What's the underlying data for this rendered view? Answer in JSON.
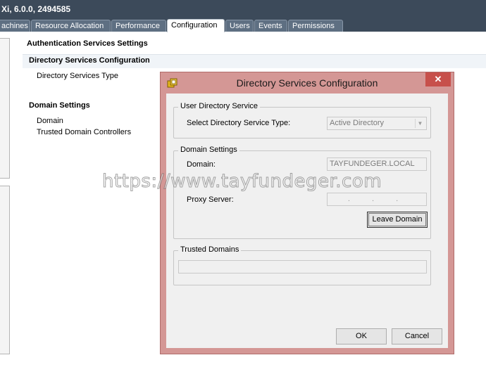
{
  "window": {
    "title": "Xi, 6.0.0, 2494585"
  },
  "tabs": [
    {
      "label": "achines"
    },
    {
      "label": "Resource Allocation"
    },
    {
      "label": "Performance"
    },
    {
      "label": "Configuration",
      "active": true
    },
    {
      "label": "Users"
    },
    {
      "label": "Events"
    },
    {
      "label": "Permissions"
    }
  ],
  "page": {
    "heading": "Authentication Services Settings",
    "directory_config": {
      "heading": "Directory Services Configuration",
      "type_label": "Directory Services Type"
    },
    "domain_settings": {
      "heading": "Domain Settings",
      "rows": [
        "Domain",
        "Trusted Domain Controllers"
      ]
    }
  },
  "dialog": {
    "title": "Directory Services Configuration",
    "close_glyph": "✕",
    "user_directory": {
      "legend": "User Directory Service",
      "select_label": "Select Directory Service Type:",
      "select_value": "Active Directory"
    },
    "domain_settings": {
      "legend": "Domain Settings",
      "domain_label": "Domain:",
      "domain_value": "TAYFUNDEGER.LOCAL",
      "proxy_label": "Proxy Server:",
      "proxy_value": ". . .",
      "leave_domain_label": "Leave Domain"
    },
    "trusted_domains": {
      "legend": "Trusted Domains"
    },
    "ok_label": "OK",
    "cancel_label": "Cancel"
  },
  "watermark": "https://www.tayfundeger.com",
  "colors": {
    "titlebar": "#3c4a5a",
    "dialog_frame": "#d49795",
    "close_button": "#c7504b"
  }
}
